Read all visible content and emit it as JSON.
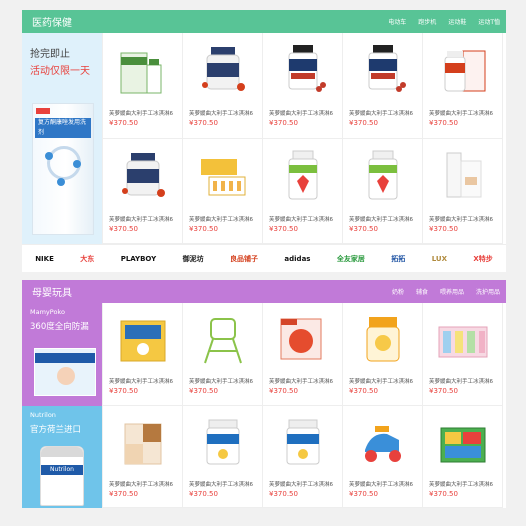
{
  "health": {
    "title": "医药保健",
    "links": [
      "电动车",
      "跑步机",
      "运动鞋",
      "运动T恤"
    ],
    "promo": {
      "line1": "抢完即止",
      "line2": "活动仅限一天",
      "box_label": "复方酮康唑发用洗剂"
    },
    "products": [
      {
        "name": "芙萝媛曲大利手工冰淇淋6",
        "price": "¥370.50",
        "icon": "medicine-box"
      },
      {
        "name": "芙萝媛曲大利手工冰淇淋6",
        "price": "¥370.50",
        "icon": "pill-bottle"
      },
      {
        "name": "芙萝媛曲大利手工冰淇淋6",
        "price": "¥370.50",
        "icon": "supplement-bottle"
      },
      {
        "name": "芙萝媛曲大利手工冰淇淋6",
        "price": "¥370.50",
        "icon": "supplement-bottle"
      },
      {
        "name": "芙萝媛曲大利手工冰淇淋6",
        "price": "¥370.50",
        "icon": "supplement-bottle-box"
      },
      {
        "name": "芙萝媛曲大利手工冰淇淋6",
        "price": "¥370.50",
        "icon": "pill-bottle"
      },
      {
        "name": "芙萝媛曲大利手工冰淇淋6",
        "price": "¥370.50",
        "icon": "vial-box"
      },
      {
        "name": "芙萝媛曲大利手工冰淇淋6",
        "price": "¥370.50",
        "icon": "vitamin-bottle"
      },
      {
        "name": "芙萝媛曲大利手工冰淇淋6",
        "price": "¥370.50",
        "icon": "vitamin-bottle"
      },
      {
        "name": "芙萝媛曲大利手工冰淇淋6",
        "price": "¥370.50",
        "icon": "gift-box"
      }
    ],
    "brands": [
      {
        "name": "NIKE",
        "color": "#111111"
      },
      {
        "name": "大东",
        "color": "#e8413c"
      },
      {
        "name": "PLAYBOY",
        "color": "#111111"
      },
      {
        "name": "御泥坊",
        "color": "#222222"
      },
      {
        "name": "良品铺子",
        "color": "#d43f1c"
      },
      {
        "name": "adidas",
        "color": "#111111"
      },
      {
        "name": "全友家居",
        "color": "#2a9a3e"
      },
      {
        "name": "拓拓",
        "color": "#1a4fa1"
      },
      {
        "name": "LUX",
        "color": "#b08a3c"
      },
      {
        "name": "X特步",
        "color": "#e8413c"
      }
    ]
  },
  "baby": {
    "title": "母婴玩具",
    "links": [
      "奶粉",
      "辅食",
      "喂养用品",
      "洗护用品"
    ],
    "promo_a": {
      "line1": "MamyPoko",
      "line2": "360度全向防漏"
    },
    "promo_b": {
      "line1": "Nutrilon",
      "line2": "官方荷兰进口",
      "can_label": "Nutrilon"
    },
    "products": [
      {
        "name": "芙萝媛曲大利手工冰淇淋6",
        "price": "¥370.50",
        "icon": "milk-powder-box"
      },
      {
        "name": "芙萝媛曲大利手工冰淇淋6",
        "price": "¥370.50",
        "icon": "high-chair"
      },
      {
        "name": "芙萝媛曲大利手工冰淇淋6",
        "price": "¥370.50",
        "icon": "snack-box"
      },
      {
        "name": "芙萝媛曲大利手工冰淇淋6",
        "price": "¥370.50",
        "icon": "baby-food-jar"
      },
      {
        "name": "芙萝媛曲大利手工冰淇淋6",
        "price": "¥370.50",
        "icon": "play-fence"
      },
      {
        "name": "芙萝媛曲大利手工冰淇淋6",
        "price": "¥370.50",
        "icon": "play-mat"
      },
      {
        "name": "芙萝媛曲大利手工冰淇淋6",
        "price": "¥370.50",
        "icon": "formula-can"
      },
      {
        "name": "芙萝媛曲大利手工冰淇淋6",
        "price": "¥370.50",
        "icon": "formula-can"
      },
      {
        "name": "芙萝媛曲大利手工冰淇淋6",
        "price": "¥370.50",
        "icon": "toy-car"
      },
      {
        "name": "芙萝媛曲大利手工冰淇淋6",
        "price": "¥370.50",
        "icon": "building-blocks"
      }
    ]
  }
}
